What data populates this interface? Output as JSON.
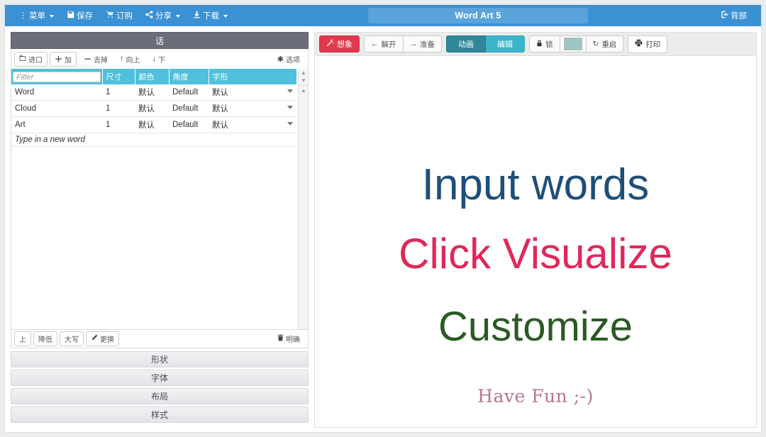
{
  "navbar": {
    "menu": {
      "label": "菜单",
      "icon": "kebab-menu-icon",
      "caret": true
    },
    "save": {
      "label": "保存",
      "icon": "floppy-disk-icon"
    },
    "order": {
      "label": "订购",
      "icon": "shopping-cart-icon"
    },
    "share": {
      "label": "分享",
      "icon": "share-icon",
      "caret": true
    },
    "download": {
      "label": "下载",
      "icon": "download-icon",
      "caret": true
    },
    "title": "Word Art 5",
    "back": {
      "label": "背部",
      "icon": "logout-icon"
    },
    "bg_color": "#3a91d4"
  },
  "left_panel": {
    "header": "话",
    "toolbar": [
      {
        "label": "进口",
        "icon": "import-icon"
      },
      {
        "label": "加",
        "icon": "plus-icon"
      },
      {
        "label": "去掉",
        "icon": "minus-icon"
      },
      {
        "label": "向上",
        "icon": "arrow-up-icon"
      },
      {
        "label": "下",
        "icon": "arrow-down-icon"
      }
    ],
    "options_button": {
      "label": "选项",
      "icon": "gear-icon"
    },
    "table": {
      "filter_placeholder": "Filter",
      "columns": [
        "尺寸",
        "颜色",
        "角度",
        "字形"
      ],
      "rows": [
        {
          "word": "Word",
          "size": "1",
          "color": "默认",
          "angle": "Default",
          "font": "默认"
        },
        {
          "word": "Cloud",
          "size": "1",
          "color": "默认",
          "angle": "Default",
          "font": "默认"
        },
        {
          "word": "Art",
          "size": "1",
          "color": "默认",
          "angle": "Default",
          "font": "默认"
        }
      ],
      "new_row_placeholder": "Type in a new word",
      "header_color": "#4fc0dd"
    },
    "bottom_toolbar": [
      {
        "label": "上",
        "icon": ""
      },
      {
        "label": "降低",
        "icon": ""
      },
      {
        "label": "大写",
        "icon": ""
      },
      {
        "label": "更换",
        "icon": "edit-icon"
      }
    ],
    "clear_button": {
      "label": "明确",
      "icon": "trash-icon"
    },
    "accordion": [
      {
        "label": "形状"
      },
      {
        "label": "字体"
      },
      {
        "label": "布局"
      },
      {
        "label": "样式"
      }
    ]
  },
  "right_panel": {
    "toolbar": {
      "visualize": {
        "label": "想象",
        "icon": "wand-icon",
        "color": "#e03a4e"
      },
      "undo": {
        "label": "解开",
        "icon": "arrow-left-icon"
      },
      "redo": {
        "label": "准备",
        "icon": "arrow-right-icon"
      },
      "animate": {
        "label": "动画",
        "color": "#2f8799"
      },
      "edit": {
        "label": "编辑",
        "color": "#3fb5cc"
      },
      "lock": {
        "label": "锁",
        "icon": "lock-icon"
      },
      "color_swatch": {
        "color": "#9dc5c3",
        "icon": "color-swatch"
      },
      "reset": {
        "label": "重启",
        "icon": "refresh-icon"
      },
      "print": {
        "label": "打印",
        "icon": "printer-icon"
      }
    },
    "canvas": {
      "lines": [
        {
          "text": "Input words",
          "color": "#1f4e79"
        },
        {
          "text": "Click Visualize",
          "color": "#e0285a"
        },
        {
          "text": "Customize",
          "color": "#2a5a23"
        },
        {
          "text": "Have Fun ;-)",
          "color": "#b5778a"
        }
      ]
    }
  }
}
